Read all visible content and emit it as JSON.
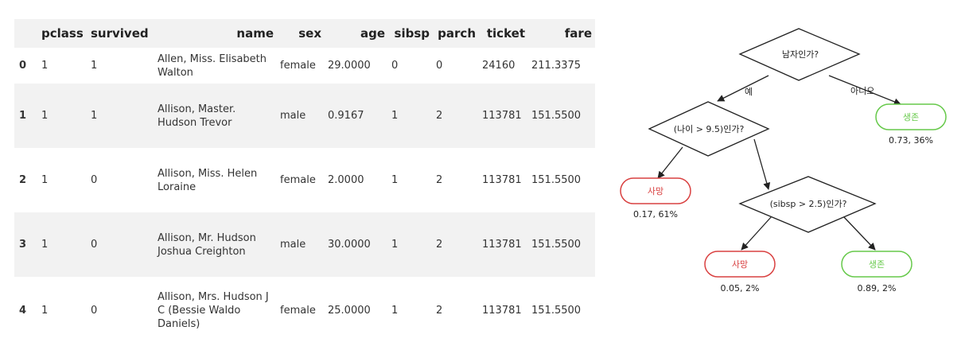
{
  "table": {
    "columns": [
      "",
      "pclass",
      "survived",
      "name",
      "sex",
      "age",
      "sibsp",
      "parch",
      "ticket",
      "fare"
    ],
    "rows": [
      [
        "0",
        "1",
        "1",
        "Allen, Miss. Elisabeth Walton",
        "female",
        "29.0000",
        "0",
        "0",
        "24160",
        "211.3375"
      ],
      [
        "1",
        "1",
        "1",
        "Allison, Master. Hudson Trevor",
        "male",
        "0.9167",
        "1",
        "2",
        "113781",
        "151.5500"
      ],
      [
        "2",
        "1",
        "0",
        "Allison, Miss. Helen Loraine",
        "female",
        "2.0000",
        "1",
        "2",
        "113781",
        "151.5500"
      ],
      [
        "3",
        "1",
        "0",
        "Allison, Mr. Hudson Joshua Creighton",
        "male",
        "30.0000",
        "1",
        "2",
        "113781",
        "151.5500"
      ],
      [
        "4",
        "1",
        "0",
        "Allison, Mrs. Hudson J C (Bessie Waldo Daniels)",
        "female",
        "25.0000",
        "1",
        "2",
        "113781",
        "151.5500"
      ]
    ]
  },
  "tree": {
    "colors": {
      "died": "#d94040",
      "survived": "#66c94a",
      "line": "#222222"
    },
    "root": {
      "label": "남자인가?"
    },
    "edge_yes": "예",
    "edge_no": "아니오",
    "age_node": {
      "label": "(나이 > 9.5)인가?"
    },
    "sibsp_node": {
      "label": "(sibsp > 2.5)인가?"
    },
    "leaf_root_no": {
      "label": "생존",
      "stat": "0.73, 36%"
    },
    "leaf_age_yes": {
      "label": "사망",
      "stat": "0.17, 61%"
    },
    "leaf_sibsp_yes": {
      "label": "사망",
      "stat": "0.05, 2%"
    },
    "leaf_sibsp_no": {
      "label": "생존",
      "stat": "0.89, 2%"
    }
  }
}
